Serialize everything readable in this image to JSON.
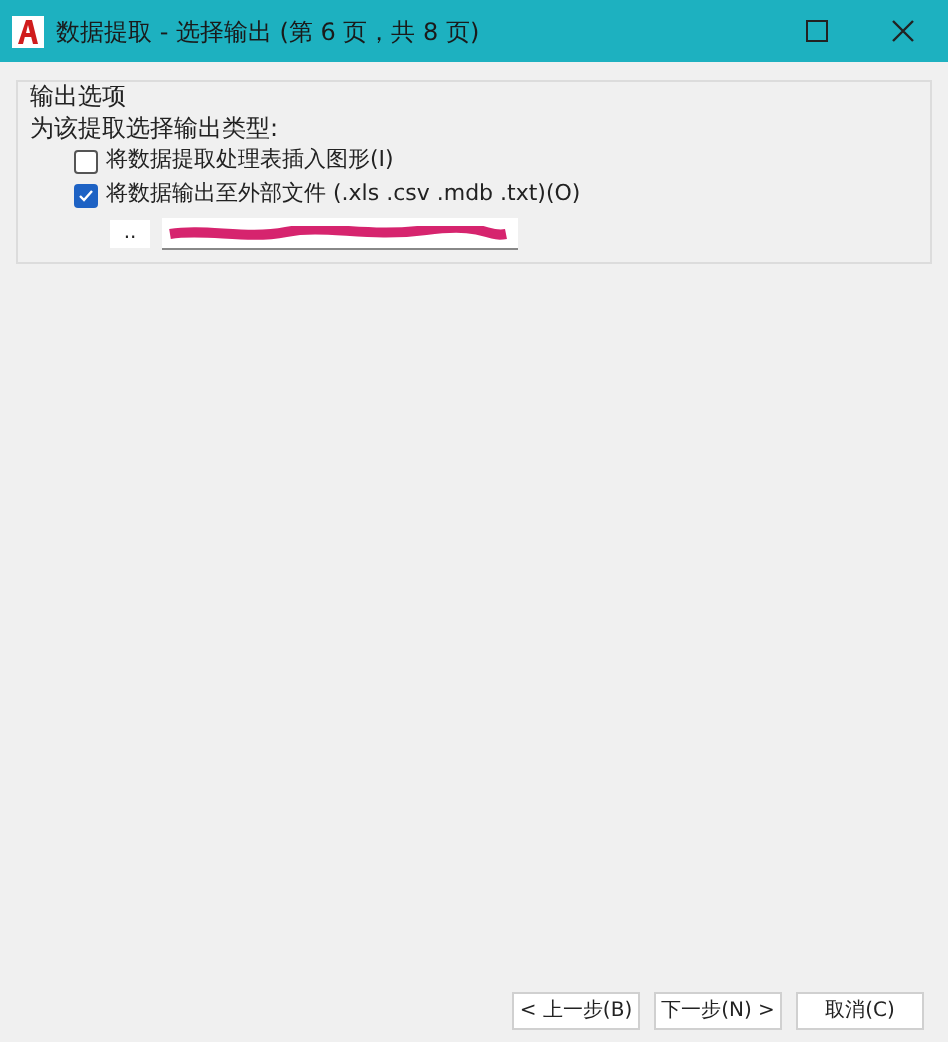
{
  "window": {
    "title": "数据提取 - 选择输出 (第 6 页，共 8 页)"
  },
  "group": {
    "title": "输出选项",
    "prompt": "为该提取选择输出类型:",
    "options": [
      {
        "label": "将数据提取处理表插入图形(I)",
        "checked": false
      },
      {
        "label": "将数据输出至外部文件 (.xls .csv .mdb .txt)(O)",
        "checked": true
      }
    ],
    "browse_button": ".."
  },
  "buttons": [
    "< 上一步(B)",
    "下一步(N) >",
    "取消(C)"
  ]
}
